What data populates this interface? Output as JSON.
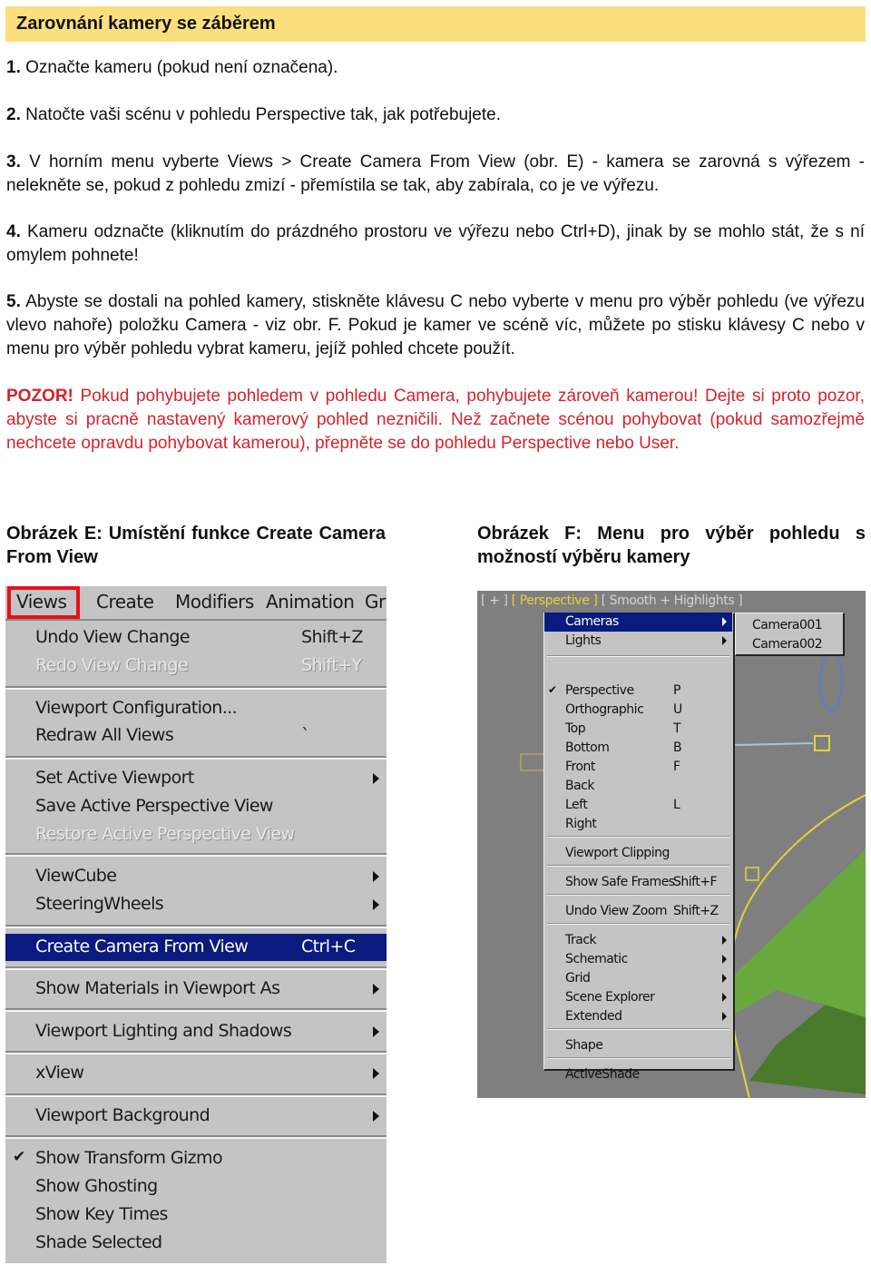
{
  "header": {
    "title": "Zarovnání kamery se záběrem"
  },
  "steps": [
    {
      "num": "1.",
      "text": " Označte kameru (pokud není označena)."
    },
    {
      "num": "2.",
      "text": " Natočte vaši scénu v pohledu Perspective tak, jak potřebujete."
    },
    {
      "num": "3.",
      "text": " V horním menu vyberte Views > Create Camera From View (obr. E) - kamera se zarovná s výřezem - nelekněte se, pokud z pohledu zmizí - přemístila se tak, aby zabírala, co je ve výřezu."
    },
    {
      "num": "4.",
      "text": " Kameru odznačte (kliknutím do prázdného prostoru ve výřezu nebo Ctrl+D), jinak by se mohlo stát, že s ní omylem pohnete!"
    },
    {
      "num": "5.",
      "text": " Abyste se dostali na pohled kamery, stiskněte klávesu C nebo vyberte v menu pro výběr pohledu (ve výřezu vlevo nahoře) položku Camera - viz obr. F. Pokud je kamer ve scéně víc, můžete po stisku klávesy C nebo v menu pro výběr pohledu vybrat kameru, jejíž pohled chcete použít."
    }
  ],
  "warning": {
    "label": "POZOR!",
    "text": " Pokud pohybujete pohledem v pohledu Camera, pohybujete zároveň kamerou! Dejte si proto pozor, abyste si pracně nastavený kamerový pohled nezničili. Než začnete scénou pohybovat (pokud samozřejmě nechcete opravdu pohybovat kamerou), přepněte se do pohledu Perspective nebo User.",
    "color": "#d4232c"
  },
  "figures": {
    "e": {
      "caption": "Obrázek E: Umístění funkce Create Camera From View",
      "menubar": [
        "Views",
        "Create",
        "Modifiers",
        "Animation",
        "Gr"
      ],
      "items": [
        {
          "label": "Undo View Change",
          "shortcut": "Shift+Z"
        },
        {
          "label": "Redo View Change",
          "shortcut": "Shift+Y",
          "disabled": true
        },
        {
          "label": "Viewport Configuration..."
        },
        {
          "label": "Redraw All Views",
          "shortcut": "`"
        },
        {
          "label": "Set Active Viewport",
          "submenu": true
        },
        {
          "label": "Save Active Perspective View"
        },
        {
          "label": "Restore Active Perspective View",
          "disabled": true
        },
        {
          "label": "ViewCube",
          "submenu": true
        },
        {
          "label": "SteeringWheels",
          "submenu": true
        },
        {
          "label": "Create Camera From View",
          "shortcut": "Ctrl+C",
          "highlighted": true
        },
        {
          "label": "Show Materials in Viewport As",
          "submenu": true
        },
        {
          "label": "Viewport Lighting and Shadows",
          "submenu": true
        },
        {
          "label": "xView",
          "submenu": true
        },
        {
          "label": "Viewport Background",
          "submenu": true
        },
        {
          "label": "Show Transform Gizmo",
          "checked": true
        },
        {
          "label": "Show Ghosting"
        },
        {
          "label": "Show Key Times"
        },
        {
          "label": "Shade Selected"
        }
      ],
      "highlight_color": "#0a1a7e",
      "box_color": "#e3121b"
    },
    "f": {
      "caption": "Obrázek F: Menu pro výběr pohledu s možností výběru kamery",
      "viewport_label": {
        "plus": "[ + ] ",
        "view": "[ Perspective ]",
        "shading": " [ Smooth + Highlights ]"
      },
      "items": [
        {
          "label": "Cameras",
          "submenu": true,
          "highlighted": true
        },
        {
          "label": "Lights",
          "submenu": true
        },
        {
          "label": "Perspective",
          "shortcut": "P",
          "checked": true
        },
        {
          "label": "Orthographic",
          "shortcut": "U"
        },
        {
          "label": "Top",
          "shortcut": "T"
        },
        {
          "label": "Bottom",
          "shortcut": "B"
        },
        {
          "label": "Front",
          "shortcut": "F"
        },
        {
          "label": "Back"
        },
        {
          "label": "Left",
          "shortcut": "L"
        },
        {
          "label": "Right"
        },
        {
          "label": "Viewport Clipping"
        },
        {
          "label": "Show Safe Frames",
          "shortcut": "Shift+F"
        },
        {
          "label": "Undo View Zoom",
          "shortcut": "Shift+Z"
        },
        {
          "label": "Track",
          "submenu": true
        },
        {
          "label": "Schematic",
          "submenu": true
        },
        {
          "label": "Grid",
          "submenu": true
        },
        {
          "label": "Scene Explorer",
          "submenu": true
        },
        {
          "label": "Extended",
          "submenu": true
        },
        {
          "label": "Shape"
        },
        {
          "label": "ActiveShade"
        }
      ],
      "submenu_items": [
        "Camera001",
        "Camera002"
      ]
    }
  }
}
